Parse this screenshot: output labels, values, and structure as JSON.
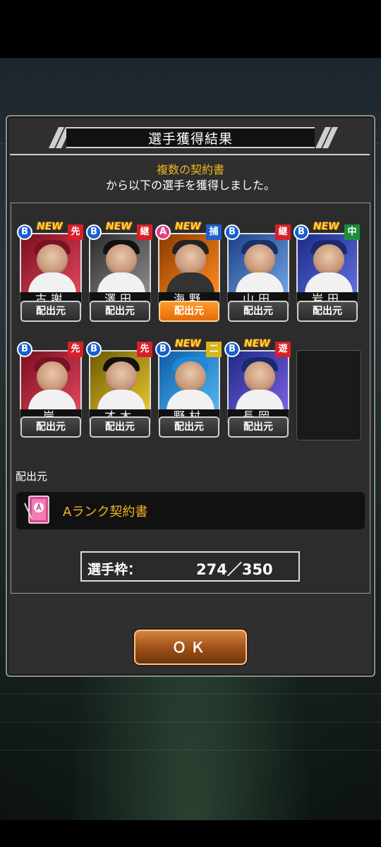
{
  "dialog": {
    "title": "選手獲得結果",
    "subtitle_highlight": "複数の契約書",
    "subtitle_text": "から以下の選手を獲得しました。"
  },
  "players": [
    {
      "name": "古謝",
      "rank": "B",
      "position": "先",
      "is_new": true,
      "source_button": "配出元",
      "selected": false
    },
    {
      "name": "澤田",
      "rank": "B",
      "position": "継",
      "is_new": true,
      "source_button": "配出元",
      "selected": false
    },
    {
      "name": "海野",
      "rank": "A",
      "position": "捕",
      "is_new": true,
      "source_button": "配出元",
      "selected": true
    },
    {
      "name": "山田",
      "rank": "B",
      "position": "継",
      "is_new": false,
      "source_button": "配出元",
      "selected": false
    },
    {
      "name": "岩田",
      "rank": "B",
      "position": "中",
      "is_new": true,
      "source_button": "配出元",
      "selected": false
    },
    {
      "name": "岸",
      "rank": "B",
      "position": "先",
      "is_new": false,
      "source_button": "配出元",
      "selected": false
    },
    {
      "name": "才木",
      "rank": "B",
      "position": "先",
      "is_new": false,
      "source_button": "配出元",
      "selected": false
    },
    {
      "name": "野村",
      "rank": "B",
      "position": "二",
      "is_new": true,
      "source_button": "配出元",
      "selected": false
    },
    {
      "name": "長岡",
      "rank": "B",
      "position": "遊",
      "is_new": true,
      "source_button": "配出元",
      "selected": false
    }
  ],
  "new_badge": "NEW",
  "source": {
    "label": "配出元",
    "contract_name": "Aランク契約書",
    "icon": "a-rank-contract-icon"
  },
  "roster": {
    "label": "選手枠：",
    "value": "274／350"
  },
  "ok_button": "ＯＫ",
  "colors": {
    "gold": "#f2b321",
    "selected_button": "#e56a09",
    "rank_b": "#1a5fd0",
    "rank_a": "#e23c8a"
  }
}
